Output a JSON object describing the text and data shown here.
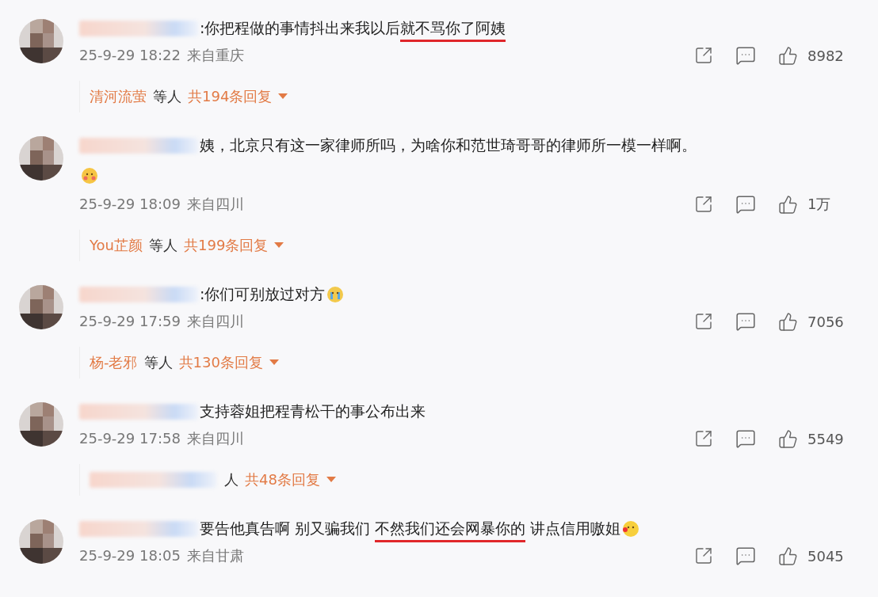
{
  "comments": [
    {
      "username": {
        "kind": "blurred"
      },
      "segments": [
        {
          "text": ":你把程做的事情抖出来我以后",
          "underlined": false
        },
        {
          "text": "就不骂你了阿姨",
          "underlined": true
        }
      ],
      "time": "25-9-29 18:22",
      "location": "来自重庆",
      "likes": "8982",
      "replies": {
        "user": {
          "kind": "name",
          "text": "清河流萤"
        },
        "others": "等人",
        "count": "共194条回复"
      }
    },
    {
      "username": {
        "kind": "blurred"
      },
      "segments": [
        {
          "text": "姨，北京只有这一家律师所吗，为啥你和范世琦哥哥的律师所一模一样啊。",
          "underlined": false
        }
      ],
      "emoji_below": {
        "kind": "blush"
      },
      "time": "25-9-29 18:09",
      "location": "来自四川",
      "likes": "1万",
      "replies": {
        "user": {
          "kind": "name",
          "text": "You芷颜"
        },
        "others": "等人",
        "count": "共199条回复"
      }
    },
    {
      "username": {
        "kind": "blurred"
      },
      "segments": [
        {
          "text": ":你们可别放过对方",
          "underlined": false
        }
      ],
      "emoji": {
        "kind": "crying"
      },
      "time": "25-9-29 17:59",
      "location": "来自四川",
      "likes": "7056",
      "replies": {
        "user": {
          "kind": "name",
          "text": "杨-老邪"
        },
        "others": "等人",
        "count": "共130条回复"
      }
    },
    {
      "username": {
        "kind": "blurred"
      },
      "segments": [
        {
          "text": "支持蓉姐把程青松干的事公布出来",
          "underlined": false
        }
      ],
      "time": "25-9-29 17:58",
      "location": "来自四川",
      "likes": "5549",
      "replies": {
        "user": {
          "kind": "blurred"
        },
        "others": "人",
        "count": "共48条回复"
      }
    },
    {
      "username": {
        "kind": "blurred"
      },
      "segments": [
        {
          "text": "要告他真告啊 别又骗我们 ",
          "underlined": false
        },
        {
          "text": "不然我们还会网暴你的",
          "underlined": true
        },
        {
          "text": " 讲点信用嗷姐",
          "underlined": false
        }
      ],
      "emoji": {
        "kind": "wink"
      },
      "time": "25-9-29 18:05",
      "location": "来自甘肃",
      "likes": "5045"
    }
  ]
}
